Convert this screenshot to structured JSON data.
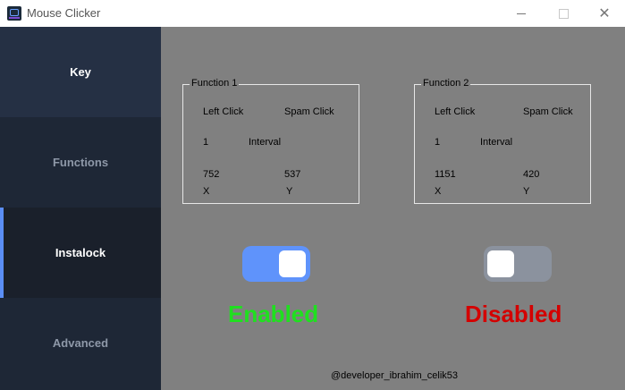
{
  "window": {
    "title": "Mouse Clicker",
    "controls": {
      "minimize_icon": "minimize-icon",
      "maximize_icon": "maximize-icon",
      "close_glyph": "✕"
    }
  },
  "sidebar": {
    "items": [
      {
        "label": "Key",
        "active": false
      },
      {
        "label": "Functions",
        "active": false
      },
      {
        "label": "Instalock",
        "active": true
      },
      {
        "label": "Advanced",
        "active": false
      }
    ],
    "accent_color": "#5b8ef5"
  },
  "functions": [
    {
      "title": "Function 1",
      "left_click": "Left Click",
      "spam_click": "Spam Click",
      "interval_value": "1",
      "interval_label": "Interval",
      "x_value": "752",
      "y_value": "537",
      "x_label": "X",
      "y_label": "Y",
      "enabled": true,
      "status": "Enabled",
      "status_color": "#1fe01f",
      "toggle_color": "#5f93fb"
    },
    {
      "title": "Function 2",
      "left_click": "Left Click",
      "spam_click": "Spam Click",
      "interval_value": "1",
      "interval_label": "Interval",
      "x_value": "1151",
      "y_value": "420",
      "x_label": "X",
      "y_label": "Y",
      "enabled": false,
      "status": "Disabled",
      "status_color": "#d40000",
      "toggle_color": "#8b929e"
    }
  ],
  "footer": {
    "credit": "@developer_ibrahim_celik53"
  }
}
